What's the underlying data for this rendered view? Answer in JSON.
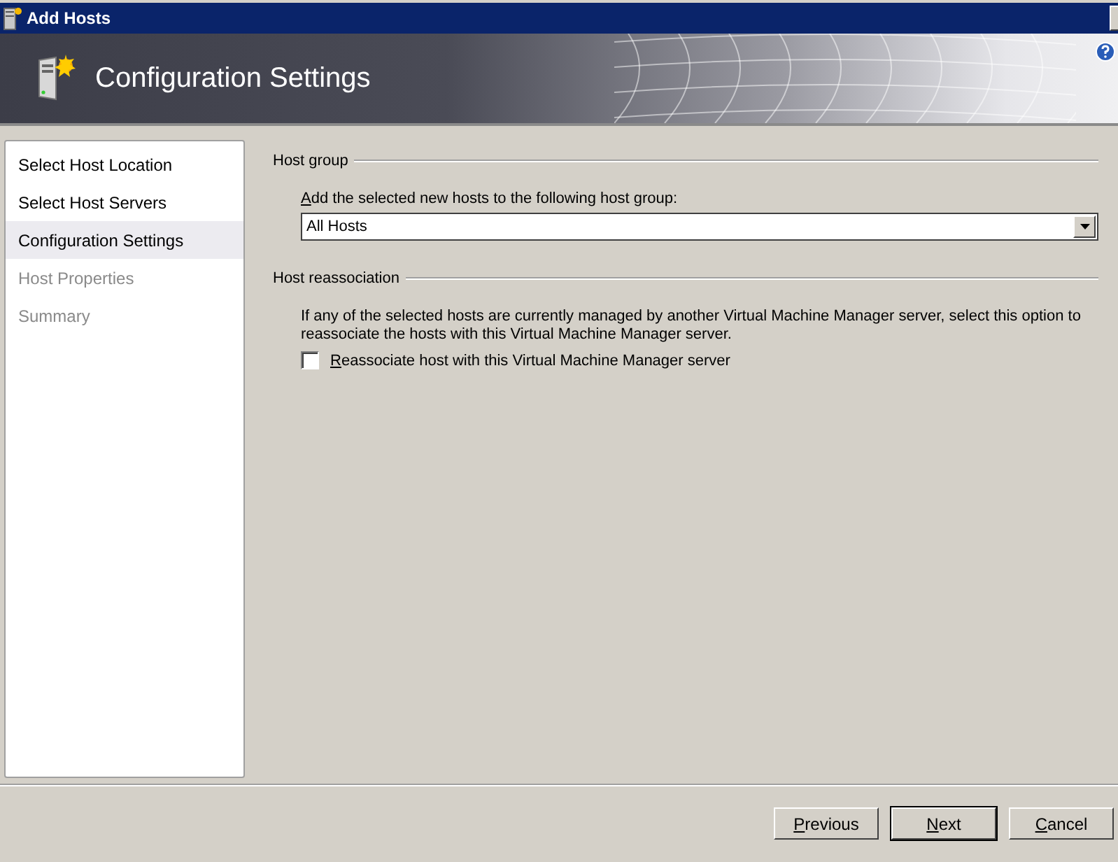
{
  "window": {
    "title": "Add Hosts"
  },
  "header": {
    "title": "Configuration Settings"
  },
  "sidebar": {
    "items": [
      {
        "label": "Select Host Location",
        "selected": false,
        "disabled": false
      },
      {
        "label": "Select Host Servers",
        "selected": false,
        "disabled": false
      },
      {
        "label": "Configuration Settings",
        "selected": true,
        "disabled": false
      },
      {
        "label": "Host Properties",
        "selected": false,
        "disabled": true
      },
      {
        "label": "Summary",
        "selected": false,
        "disabled": true
      }
    ]
  },
  "host_group": {
    "heading": "Host group",
    "label": "Add the selected new hosts to the following host group:",
    "value": "All Hosts"
  },
  "host_reassociation": {
    "heading": "Host reassociation",
    "description": "If any of the selected hosts are currently managed by another Virtual Machine Manager server, select this option to reassociate the hosts with this Virtual Machine Manager server.",
    "checkbox": {
      "label": "Reassociate host with this Virtual Machine Manager server",
      "checked": false
    }
  },
  "buttons": [
    {
      "label": "Previous",
      "default": false
    },
    {
      "label": "Next",
      "default": true
    },
    {
      "label": "Cancel",
      "default": false
    }
  ]
}
